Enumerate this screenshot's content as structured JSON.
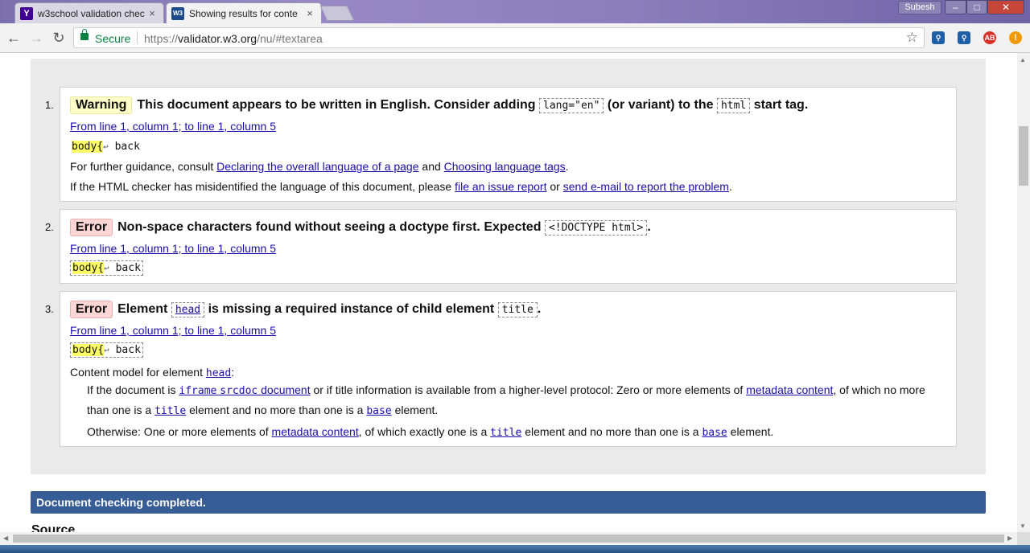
{
  "tabs": [
    {
      "title": "w3school validation chec",
      "close": "×",
      "favicon": "Y",
      "favicon_color": "#400191"
    },
    {
      "title": "Showing results for conte",
      "close": "×",
      "favicon": "W3",
      "favicon_color": "#1b4a8a"
    }
  ],
  "user_label": "Subesh",
  "window_controls": {
    "minimize": "–",
    "maximize": "□",
    "close": "✕"
  },
  "nav": {
    "back": "←",
    "forward": "→",
    "reload": "↻"
  },
  "address": {
    "secure_label": "Secure",
    "scheme": "https://",
    "host": "validator.w3.org",
    "path": "/nu/#textarea",
    "bookmark": "☆"
  },
  "extensions": [
    {
      "icon": "search-icon",
      "color": "#1f5fa8"
    },
    {
      "icon": "search-icon",
      "color": "#1f5fa8"
    },
    {
      "icon": "adblock-icon",
      "color": "#d93025",
      "text": "AB"
    },
    {
      "icon": "alert-icon",
      "color": "#f29900",
      "text": "!"
    }
  ],
  "messages": [
    {
      "number": "1.",
      "badge": "Warning",
      "text_a": "This document appears to be written in English. Consider adding",
      "code_a": "lang=\"en\"",
      "text_b": "(or variant) to the",
      "code_b": "html",
      "text_c": "start tag.",
      "location": "From line 1, column 1; to line 1, column 5",
      "extract_hl": "body{",
      "extract_rest": " back",
      "guidance_pre": "For further guidance, consult",
      "guidance_link1": "Declaring the overall language of a page",
      "guidance_and": "and",
      "guidance_link2": "Choosing language tags",
      "guidance_end": ".",
      "misid_pre": "If the HTML checker has misidentified the language of this document, please",
      "misid_link1": "file an issue report",
      "misid_or": "or",
      "misid_link2": "send e-mail to report the problem",
      "misid_end": "."
    },
    {
      "number": "2.",
      "badge": "Error",
      "text_a": "Non-space characters found without seeing a doctype first. Expected",
      "code_a": "<!DOCTYPE html>",
      "text_end": ".",
      "location": "From line 1, column 1; to line 1, column 5",
      "extract_hl": "body{",
      "extract_rest": " back"
    },
    {
      "number": "3.",
      "badge": "Error",
      "text_a": "Element",
      "code_a": "head",
      "text_b": "is missing a required instance of child element",
      "code_b": "title",
      "text_end": ".",
      "location": "From line 1, column 1; to line 1, column 5",
      "extract_hl": "body{",
      "extract_rest": " back",
      "content_model_pre": "Content model for element",
      "content_model_el": "head",
      "content_model_end": ":",
      "p1_a": "If the document is",
      "p1_link_code": "iframe",
      "p1_link_code2": "srcdoc",
      "p1_link_text": "document",
      "p1_b": "or if title information is available from a higher-level protocol: Zero or more elements of",
      "p1_link2": "metadata content",
      "p1_c": ", of which no more",
      "p1_d": "than one is a",
      "p1_title": "title",
      "p1_e": "element and no more than one is a",
      "p1_base": "base",
      "p1_f": "element.",
      "p2_a": "Otherwise: One or more elements of",
      "p2_link": "metadata content",
      "p2_b": ", of which exactly one is a",
      "p2_title": "title",
      "p2_c": "element and no more than one is a",
      "p2_base": "base",
      "p2_d": "element."
    }
  ],
  "status_bar": "Document checking completed.",
  "source_heading": "Source"
}
